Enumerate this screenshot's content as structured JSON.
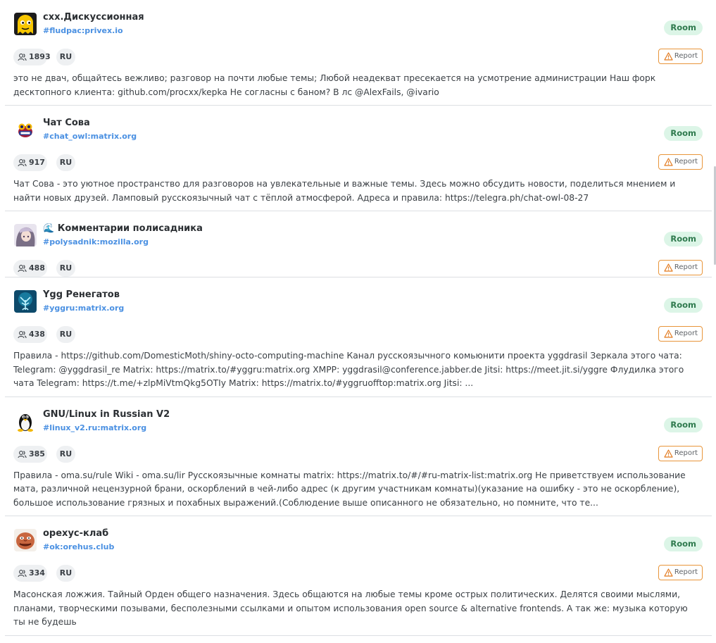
{
  "report_label": "Report",
  "rooms": [
    {
      "avatar": "yellow-ghost-avatar",
      "title": "схх.Дискуссионная",
      "alias": "#fludpac:privex.io",
      "type": "Room",
      "members": "1893",
      "language": "RU",
      "topic": "это не двач, общайтесь вежливо; разговор на почти любые темы; Любой неадекват пресекается на усмотрение администрации Наш форк десктопного клиента: github.com/procxx/kepka Не согласны с баном? В лс @AlexFails, @ivario"
    },
    {
      "avatar": "owl-logo-avatar",
      "title": "Чат Сова",
      "alias": "#chat_owl:matrix.org",
      "type": "Room",
      "members": "917",
      "language": "RU",
      "topic": "Чат Сова - это уютное пространство для разговоров на увлекательные и важные темы. Здесь можно обсудить новости, поделиться мнением и найти новых друзей. Ламповый русскоязычный чат с тёплой атмосферой. Адреса и правила: https://telegra.ph/chat-owl-08-27"
    },
    {
      "avatar": "anime-character-avatar",
      "title": "🌊 Комментарии полисадника",
      "alias": "#polysadnik:mozilla.org",
      "type": "Room",
      "members": "488",
      "language": "RU",
      "topic": ""
    },
    {
      "avatar": "yggdrasil-tree-avatar",
      "title": "Ygg Ренегатов",
      "alias": "#yggru:matrix.org",
      "type": "Room",
      "members": "438",
      "language": "RU",
      "topic": "Правила - https://github.com/DomesticMoth/shiny-octo-computing-machine Канал русскоязычного комьюнити проекта yggdrasil Зеркала этого чата: Telegram: @yggdrasil_re Matrix: https://matrix.to/#yggru:matrix.org XMPP: yggdrasil@conference.jabber.de Jitsi: https://meet.jit.si/yggre Флудилка этого чата Telegram: https://t.me/+zlpMiVtmQkg5OTIy Matrix: https://matrix.to/#yggruofftop:matrix.org Jitsi: ..."
    },
    {
      "avatar": "tux-penguin-avatar",
      "title": "GNU/Linux in Russian V2",
      "alias": "#linux_v2.ru:matrix.org",
      "type": "Room",
      "members": "385",
      "language": "RU",
      "topic": "Правила - oma.su/rule Wiki - oma.su/lir Русскоязычные комнаты matrix: https://matrix.to/#/#ru-matrix-list:matrix.org Не приветствуем использование мата, различной нецензурной брани, оскорблений в чей-либо адрес (к другим участникам комнаты)(указание на ошибку - это не оскорбление), большое использование грязных и похабных выражений.(Соблюдение выше описанного не обязательно, но помните, что те..."
    },
    {
      "avatar": "cartoon-face-avatar",
      "title": "орехус-клаб",
      "alias": "#ok:orehus.club",
      "type": "Room",
      "members": "334",
      "language": "RU",
      "topic": "Масонская ложжия. Тайный Орден общего назначения. Здесь общаются на любые темы кроме острых политических. Делятся своими мыслями, планами, творческими позывами, бесполезными ссылками и опытом использования open source & alternative frontends. А так же: музыка которую ты не будешь"
    }
  ]
}
